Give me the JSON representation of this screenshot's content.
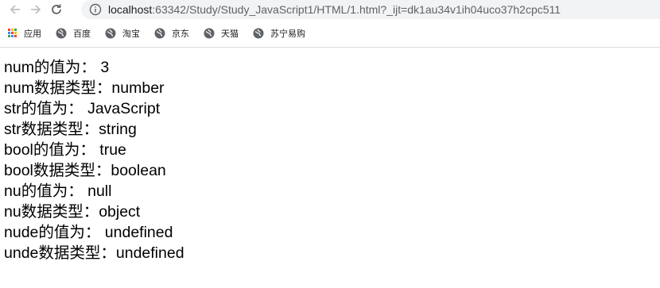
{
  "browser": {
    "url_host": "localhost",
    "url_rest": ":63342/Study/Study_JavaScript1/HTML/1.html?_ijt=dk1au34v1ih04uco37h2cpc511",
    "bookmarks": [
      {
        "label": "应用",
        "icon": "apps-grid-icon"
      },
      {
        "label": "百度",
        "icon": "globe-icon"
      },
      {
        "label": "淘宝",
        "icon": "globe-icon"
      },
      {
        "label": "京东",
        "icon": "globe-icon"
      },
      {
        "label": "天猫",
        "icon": "globe-icon"
      },
      {
        "label": "苏宁易购",
        "icon": "globe-icon"
      }
    ]
  },
  "output_lines": [
    "num的值为： 3",
    "num数据类型：number",
    "str的值为： JavaScript",
    "str数据类型：string",
    "bool的值为： true",
    "bool数据类型：boolean",
    "nu的值为： null",
    "nu数据类型：object",
    "nude的值为： undefined",
    "unde数据类型：undefined"
  ],
  "colors": {
    "address_bar_bg": "#f1f3f4",
    "icon_gray": "#5f6368",
    "nav_disabled": "#bdc1c6"
  }
}
